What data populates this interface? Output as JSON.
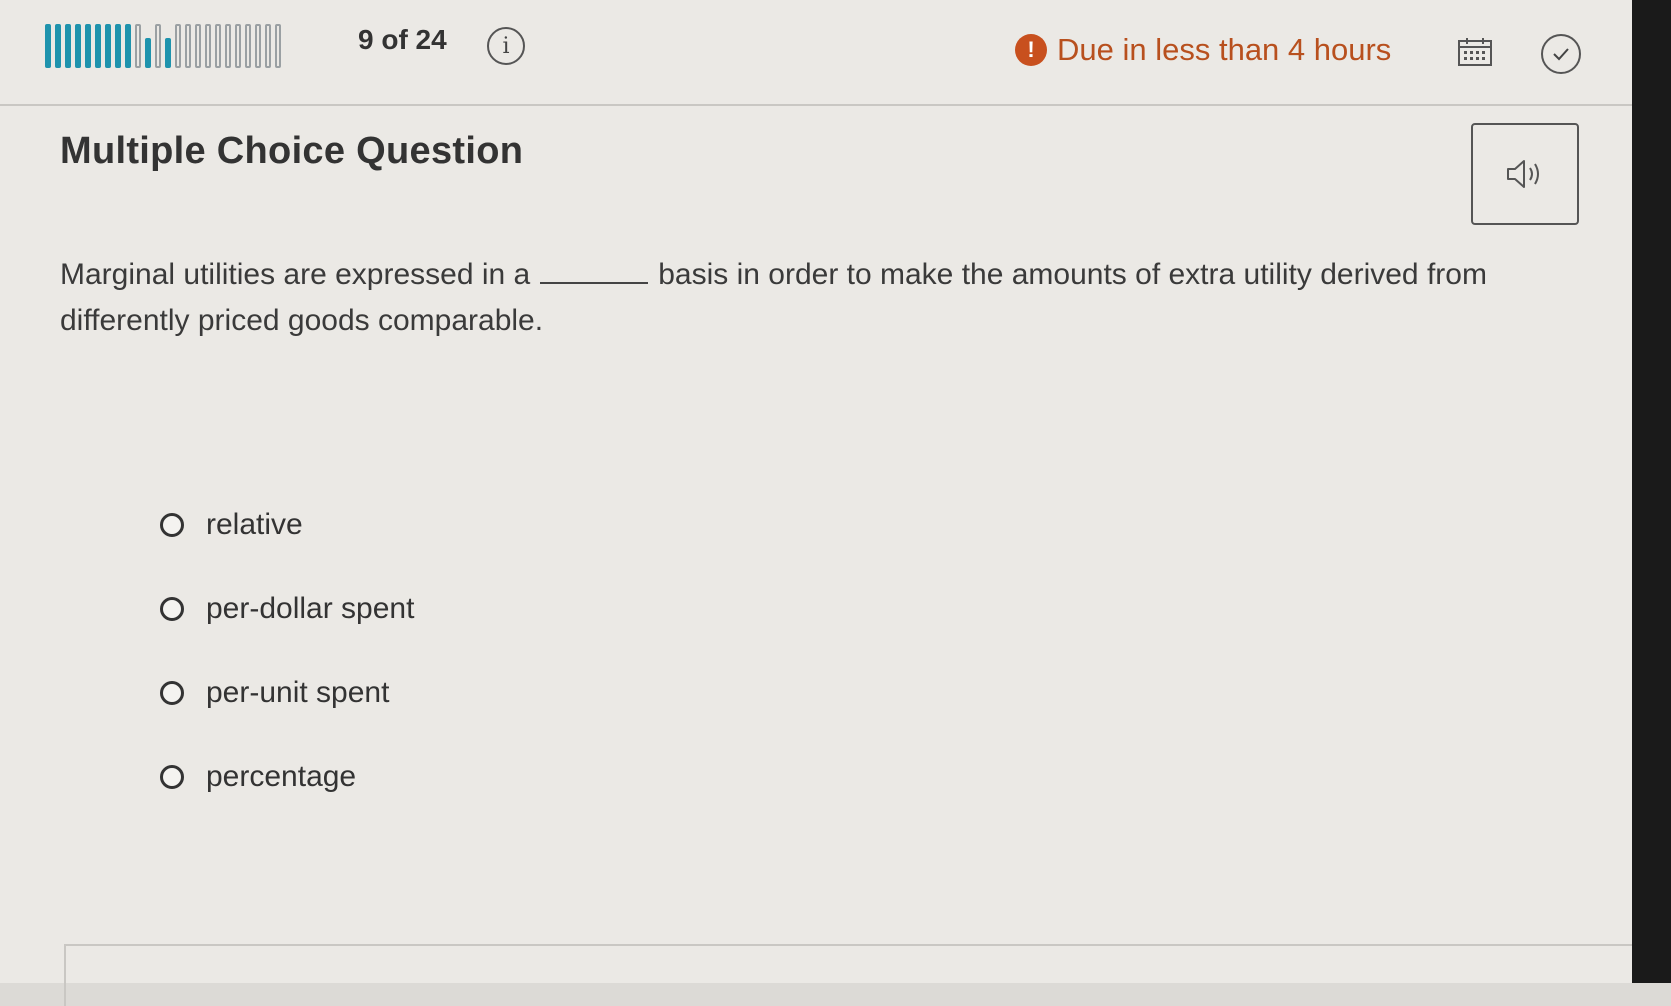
{
  "header": {
    "progress": {
      "current": 9,
      "total": 24,
      "label": "9 of 24"
    },
    "due_text": "Due in less than 4 hours",
    "icons": {
      "info": "info-icon",
      "warning": "warning-icon",
      "calendar": "calendar-icon",
      "check": "check-circle-icon",
      "audio": "speaker-icon"
    },
    "accent_color": "#1e93ad",
    "due_color": "#c8501e"
  },
  "question": {
    "type_label": "Multiple Choice Question",
    "prompt_before": "Marginal utilities are expressed in a",
    "prompt_after": "basis in order to make the amounts of extra utility derived from differently priced goods comparable.",
    "options": [
      "relative",
      "per-dollar spent",
      "per-unit spent",
      "percentage"
    ]
  }
}
